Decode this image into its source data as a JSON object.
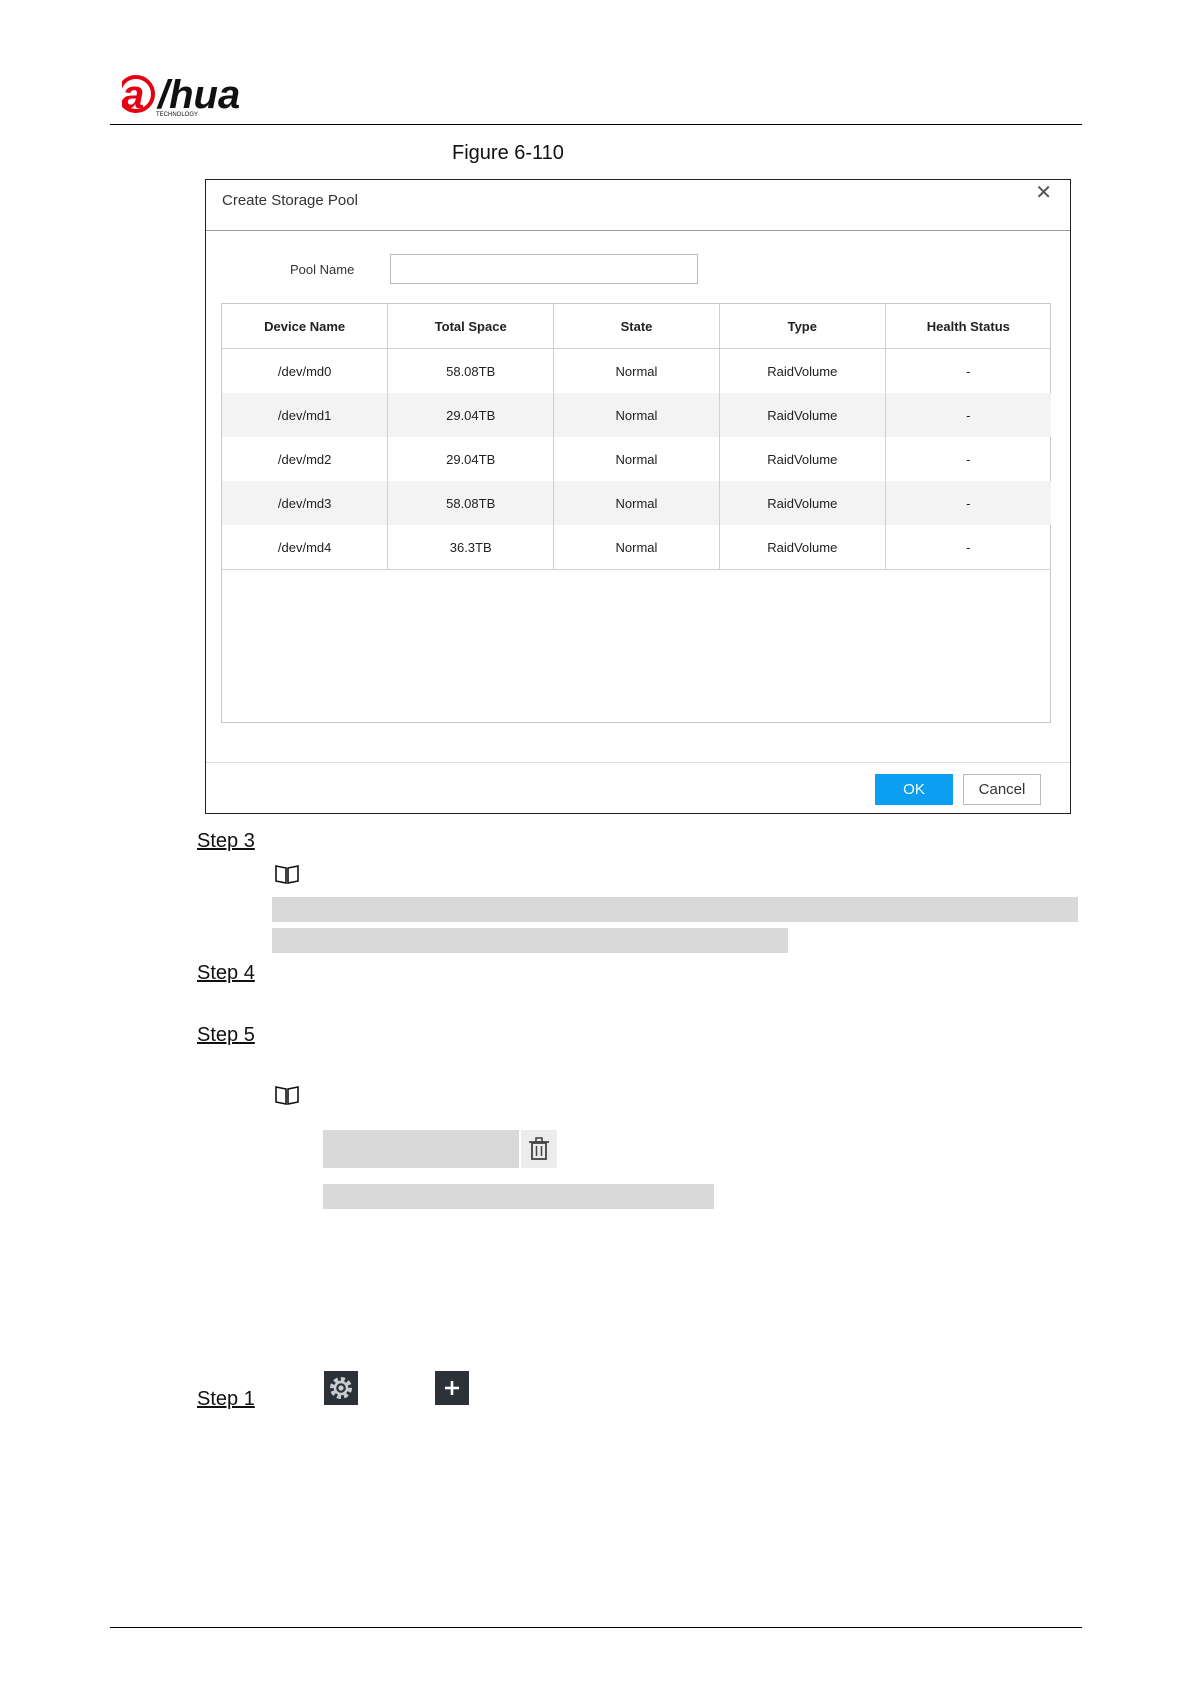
{
  "brand": {
    "logo_text": "alhua",
    "logo_subtext": "TECHNOLOGY",
    "color": "#e60012"
  },
  "figure": {
    "caption": "Figure 6-110"
  },
  "dialog": {
    "title": "Create Storage Pool",
    "close_icon": "close-icon",
    "pool_name_label": "Pool Name",
    "pool_name_value": "",
    "columns": [
      "Device Name",
      "Total Space",
      "State",
      "Type",
      "Health Status"
    ],
    "rows": [
      [
        "/dev/md0",
        "58.08TB",
        "Normal",
        "RaidVolume",
        "-"
      ],
      [
        "/dev/md1",
        "29.04TB",
        "Normal",
        "RaidVolume",
        "-"
      ],
      [
        "/dev/md2",
        "29.04TB",
        "Normal",
        "RaidVolume",
        "-"
      ],
      [
        "/dev/md3",
        "58.08TB",
        "Normal",
        "RaidVolume",
        "-"
      ],
      [
        "/dev/md4",
        "36.3TB",
        "Normal",
        "RaidVolume",
        "-"
      ]
    ],
    "ok_label": "OK",
    "cancel_label": "Cancel",
    "accent_color": "#0a9ff0"
  },
  "steps": {
    "step3": "Step 3",
    "step4": "Step 4",
    "step5": "Step 5",
    "step1": "Step 1"
  },
  "icons": {
    "note": "book-icon",
    "delete": "trash-icon",
    "settings": "gear-icon",
    "add": "plus-icon"
  }
}
